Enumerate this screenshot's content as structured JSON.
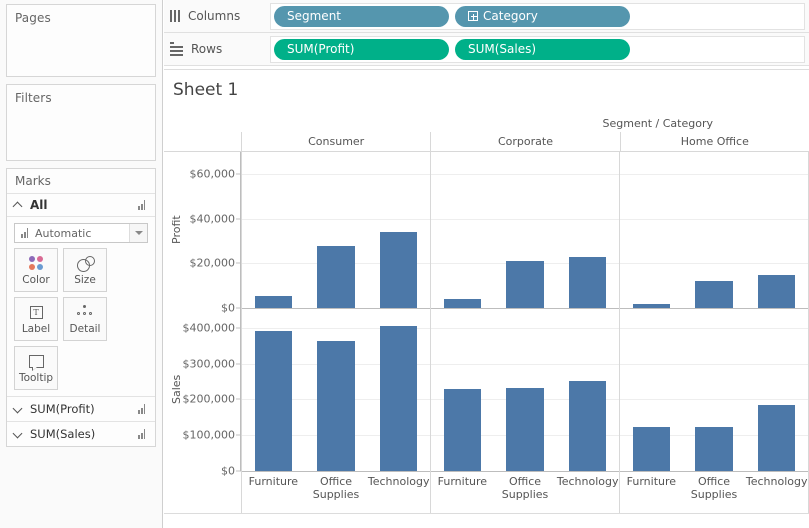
{
  "left_panel": {
    "pages": {
      "title": "Pages"
    },
    "filters": {
      "title": "Filters"
    },
    "marks": {
      "title": "Marks",
      "all_label": "All",
      "mark_type": "Automatic",
      "buttons": [
        {
          "label": "Color",
          "icon": "color-dots-icon"
        },
        {
          "label": "Size",
          "icon": "size-circles-icon"
        },
        {
          "label": "Label",
          "icon": "label-text-icon"
        },
        {
          "label": "Detail",
          "icon": "detail-dots-icon"
        },
        {
          "label": "Tooltip",
          "icon": "tooltip-bubble-icon"
        }
      ],
      "color_swatches": [
        "#8d6ab8",
        "#e4785c",
        "#d96a94",
        "#6a9bd1"
      ],
      "label_glyph": "T"
    },
    "fields": [
      {
        "label": "SUM(Profit)",
        "icon": "bar-chart-icon"
      },
      {
        "label": "SUM(Sales)",
        "icon": "bar-chart-icon"
      }
    ]
  },
  "shelves": {
    "columns": {
      "label": "Columns",
      "icon": "columns-icon",
      "pills": [
        {
          "text": "Segment",
          "color": "#5596ae",
          "expandable": false
        },
        {
          "text": "Category",
          "color": "#5596ae",
          "expandable": true
        }
      ]
    },
    "rows": {
      "label": "Rows",
      "icon": "rows-icon",
      "pills": [
        {
          "text": "SUM(Profit)",
          "color": "#00b089",
          "expandable": false
        },
        {
          "text": "SUM(Sales)",
          "color": "#00b089",
          "expandable": false
        }
      ]
    }
  },
  "worksheet": {
    "title": "Sheet 1",
    "column_header_title": "Segment / Category",
    "bottom_rule": true
  },
  "chart_data": {
    "type": "bar",
    "title": "Sheet 1",
    "column_header_title": "Segment / Category",
    "groups": [
      "Consumer",
      "Corporate",
      "Home Office"
    ],
    "categories": [
      "Furniture",
      "Office Supplies",
      "Technology"
    ],
    "mark_color": "#4c78a8",
    "grid": true,
    "legend_position": "none",
    "panels": [
      {
        "name": "profit",
        "ylabel": "Profit",
        "ylim": [
          0,
          70000
        ],
        "yticks": [
          0,
          20000,
          40000,
          60000
        ],
        "ytick_labels": [
          "$0",
          "$20,000",
          "$40,000",
          "$60,000"
        ],
        "series": [
          {
            "name": "Consumer",
            "values": [
              5500,
              28000,
              34000
            ]
          },
          {
            "name": "Corporate",
            "values": [
              4000,
              21000,
              23000
            ]
          },
          {
            "name": "Home Office",
            "values": [
              1600,
              12300,
              14600
            ]
          }
        ]
      },
      {
        "name": "sales",
        "ylabel": "Sales",
        "ylim": [
          0,
          455000
        ],
        "yticks": [
          0,
          100000,
          200000,
          300000,
          400000
        ],
        "ytick_labels": [
          "$0",
          "$100,000",
          "$200,000",
          "$300,000",
          "$400,000"
        ],
        "series": [
          {
            "name": "Consumer",
            "values": [
              390000,
              363000,
              406000
            ]
          },
          {
            "name": "Corporate",
            "values": [
              228000,
              231000,
              250000
            ]
          },
          {
            "name": "Home Office",
            "values": [
              124000,
              122000,
              183000
            ]
          }
        ]
      }
    ]
  }
}
